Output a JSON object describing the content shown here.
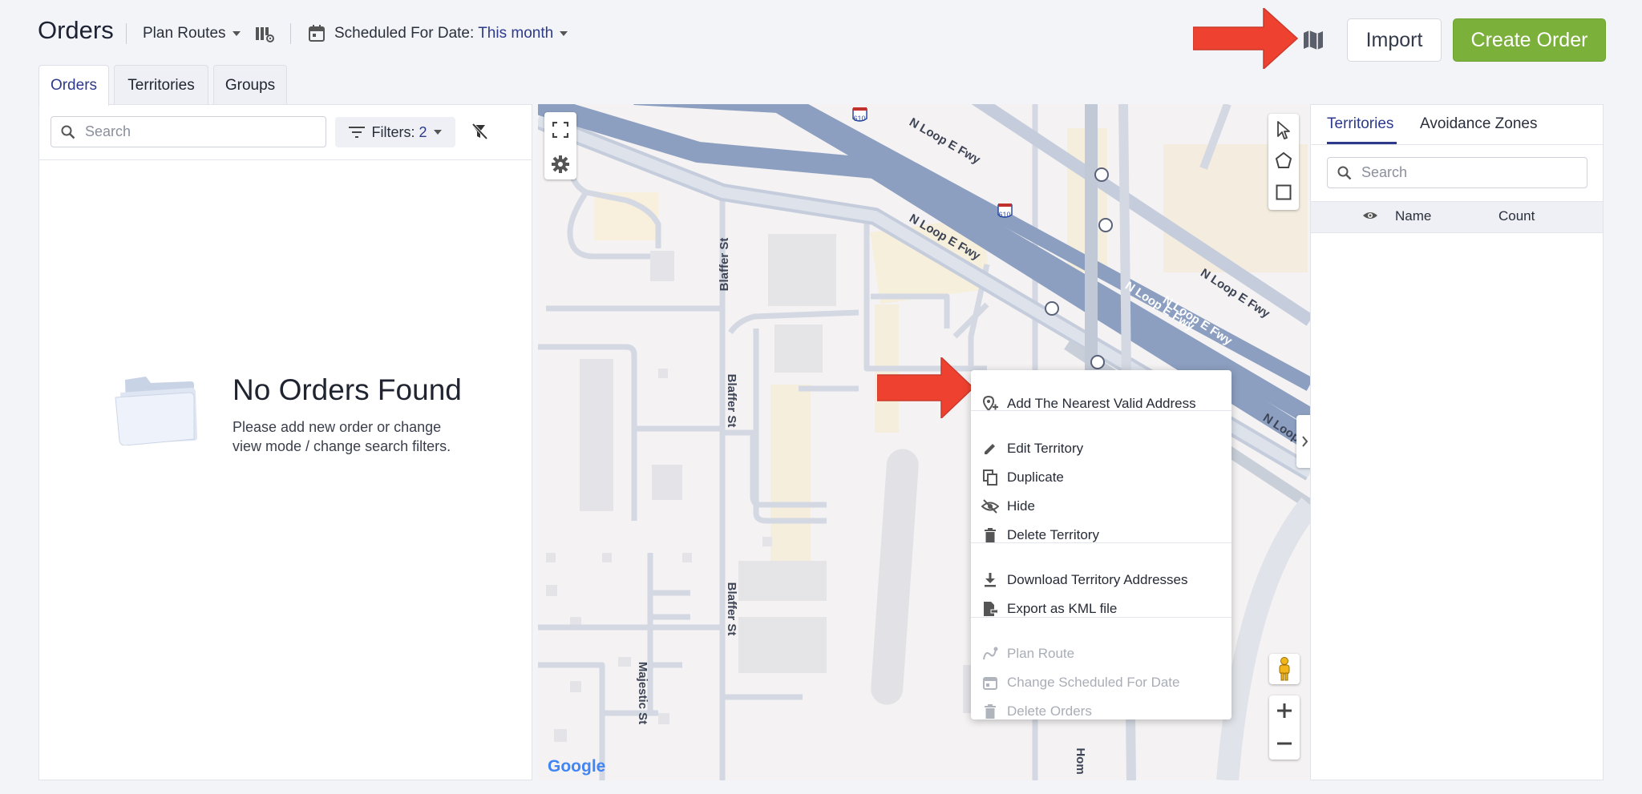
{
  "header": {
    "title": "Orders",
    "plan_routes": "Plan Routes",
    "scheduled_label": "Scheduled For Date: ",
    "scheduled_value": "This month",
    "import_label": "Import",
    "create_order_label": "Create Order",
    "icons": [
      "board-settings-icon",
      "calendar-icon",
      "map-icon"
    ]
  },
  "tabs": [
    {
      "label": "Orders",
      "active": true
    },
    {
      "label": "Territories",
      "active": false
    },
    {
      "label": "Groups",
      "active": false
    }
  ],
  "left": {
    "search_placeholder": "Search",
    "filters_label": "Filters: ",
    "filters_count": "2",
    "empty_title": "No Orders Found",
    "empty_text": "Please add new order or change view mode / change search filters."
  },
  "map": {
    "street_labels": [
      "Blaffer St",
      "Blaffer St",
      "Blaffer St",
      "Majestic St",
      "Hom",
      "N Loop E Fwy",
      "N Loop E Fwy",
      "N Loop E Fwy",
      "N Loop E Fwy",
      "N Loop E Fwy",
      "N Loop"
    ],
    "highway_shield": "610",
    "attribution": "Google"
  },
  "context_menu": {
    "groups": [
      [
        {
          "label": "Add The Nearest Valid Address",
          "icon": "location-add-icon",
          "disabled": false
        }
      ],
      [
        {
          "label": "Edit Territory",
          "icon": "pencil-icon",
          "disabled": false
        },
        {
          "label": "Duplicate",
          "icon": "copy-icon",
          "disabled": false
        },
        {
          "label": "Hide",
          "icon": "eye-off-icon",
          "disabled": false
        },
        {
          "label": "Delete Territory",
          "icon": "trash-icon",
          "disabled": false
        }
      ],
      [
        {
          "label": "Download Territory Addresses",
          "icon": "download-icon",
          "disabled": false
        },
        {
          "label": "Export as KML file",
          "icon": "file-export-icon",
          "disabled": false
        }
      ],
      [
        {
          "label": "Plan Route",
          "icon": "route-icon",
          "disabled": true
        },
        {
          "label": "Change Scheduled For Date",
          "icon": "calendar-icon",
          "disabled": true
        },
        {
          "label": "Delete Orders",
          "icon": "trash-icon",
          "disabled": true
        }
      ]
    ]
  },
  "right": {
    "tabs": [
      {
        "label": "Territories",
        "active": true
      },
      {
        "label": "Avoidance Zones",
        "active": false
      }
    ],
    "search_placeholder": "Search",
    "columns": [
      "Name",
      "Count"
    ]
  },
  "colors": {
    "accent": "#2d3a8c",
    "create_button": "#7bb03a",
    "annotation_arrow": "#ef4130",
    "highway": "#8c9fc0"
  }
}
